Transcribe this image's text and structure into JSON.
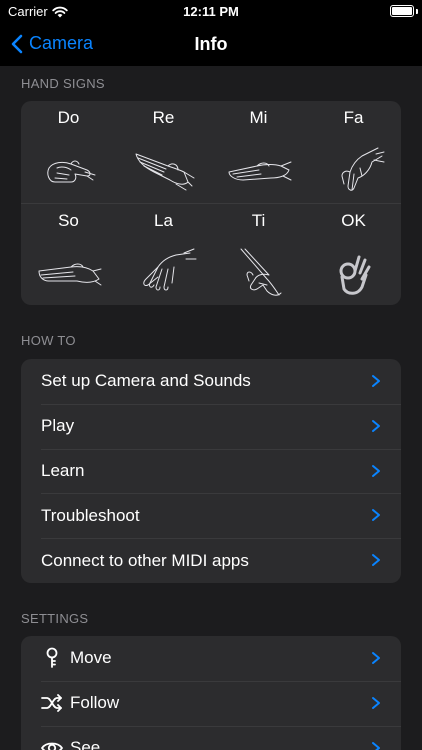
{
  "status_bar": {
    "carrier": "Carrier",
    "time": "12:11 PM",
    "battery_level": 1.0
  },
  "nav": {
    "back_label": "Camera",
    "title": "Info"
  },
  "sections": {
    "hand_signs": {
      "header": "HAND SIGNS",
      "signs": [
        "Do",
        "Re",
        "Mi",
        "Fa",
        "So",
        "La",
        "Ti",
        "OK"
      ]
    },
    "how_to": {
      "header": "HOW TO",
      "items": [
        "Set up Camera and Sounds",
        "Play",
        "Learn",
        "Troubleshoot",
        "Connect to other MIDI apps"
      ]
    },
    "settings": {
      "header": "SETTINGS",
      "items": [
        {
          "label": "Move",
          "icon": "key-icon"
        },
        {
          "label": "Follow",
          "icon": "shuffle-icon"
        },
        {
          "label": "See",
          "icon": "eye-icon"
        }
      ]
    }
  },
  "colors": {
    "accent": "#0a84ff",
    "background": "#1c1c1e",
    "card": "#2c2c2e",
    "secondary_text": "#8e8e93"
  }
}
